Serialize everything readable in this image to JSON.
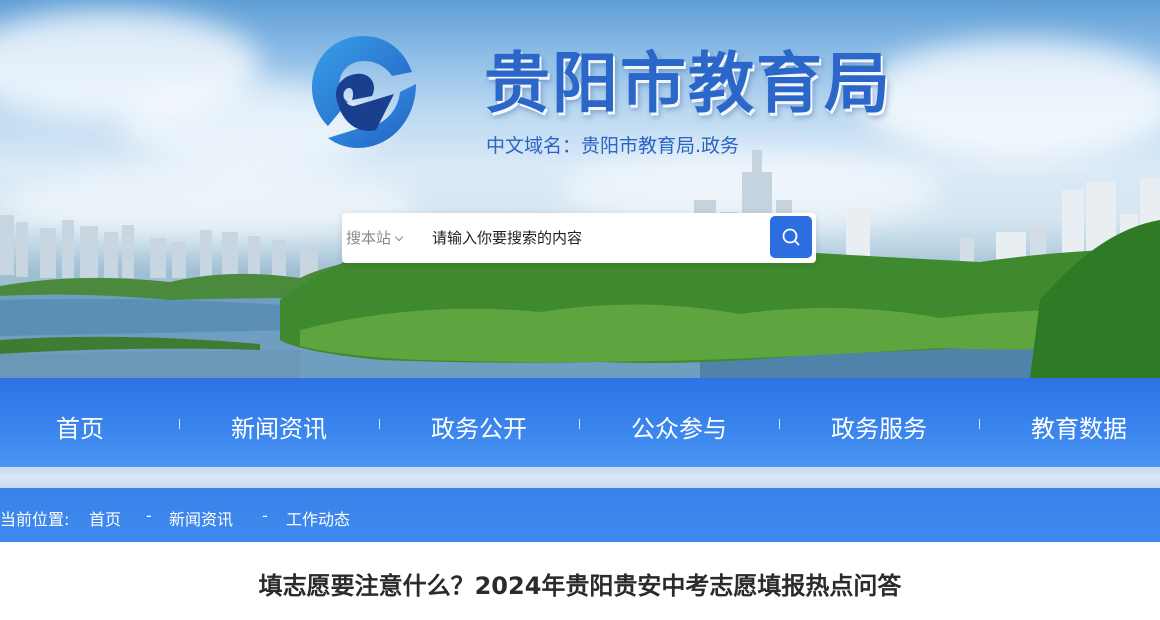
{
  "header": {
    "site_title": "贵阳市教育局",
    "domain_line": "中文域名：贵阳市教育局.政务",
    "logo_icon": "e-letter-swoosh-logo"
  },
  "search": {
    "scope_label": "搜本站",
    "placeholder": "请输入你要搜索的内容",
    "button_icon": "search-icon"
  },
  "nav": {
    "items": [
      {
        "label": "首页"
      },
      {
        "label": "新闻资讯"
      },
      {
        "label": "政务公开"
      },
      {
        "label": "公众参与"
      },
      {
        "label": "政务服务"
      },
      {
        "label": "教育数据"
      }
    ]
  },
  "breadcrumb": {
    "prefix": "当前位置:",
    "items": [
      "首页",
      "新闻资讯",
      "工作动态"
    ],
    "separator": "-"
  },
  "article": {
    "title": "填志愿要注意什么？2024年贵阳贵安中考志愿填报热点问答"
  },
  "colors": {
    "brand_blue": "#2c6de0",
    "nav_blue": "#3b86ee",
    "title_blue": "#2b66c9"
  }
}
